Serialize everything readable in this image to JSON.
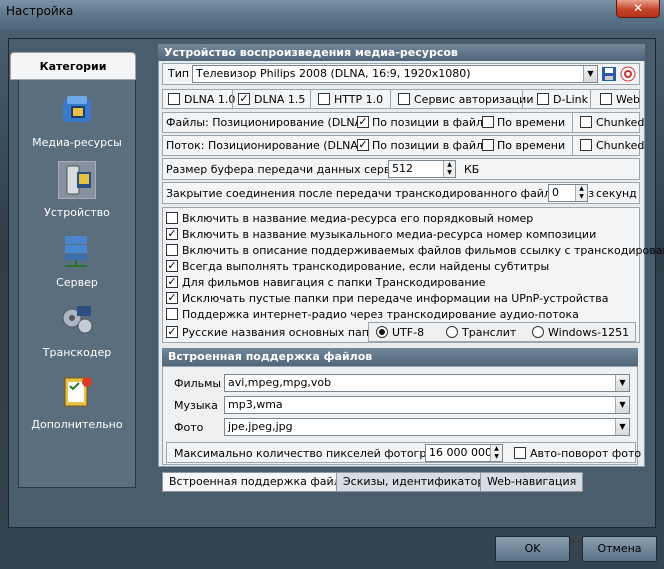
{
  "window": {
    "title": "Настройка",
    "close_icon": "close-icon"
  },
  "sidebar": {
    "header": "Категории",
    "items": [
      {
        "label": "Медиа-ресурсы",
        "icon": "media-resources-icon"
      },
      {
        "label": "Устройство",
        "icon": "device-icon"
      },
      {
        "label": "Сервер",
        "icon": "server-icon"
      },
      {
        "label": "Транскодер",
        "icon": "transcoder-icon"
      },
      {
        "label": "Дополнительно",
        "icon": "additional-icon"
      }
    ]
  },
  "panel": {
    "title": "Устройство воспроизведения медиа-ресурсов",
    "type_label": "Тип",
    "type_value": "Телевизор Philips 2008 (DLNA, 16:9, 1920x1080)",
    "flags": [
      {
        "label": "DLNA 1.0",
        "checked": false
      },
      {
        "label": "DLNA 1.5",
        "checked": true
      },
      {
        "label": "HTTP 1.0",
        "checked": false
      },
      {
        "label": "Сервис авторизации",
        "checked": false
      },
      {
        "label": "D-Link",
        "checked": false
      },
      {
        "label": "Web",
        "checked": false
      }
    ],
    "files_pos_label": "Файлы: Позиционирование (DLNA):",
    "stream_pos_label": "Поток: Позиционирование (DLNA):",
    "by_position": "По позиции в файле",
    "by_time": "По времени",
    "chunked": "Chunked",
    "buffer_label": "Размер буфера передачи данных сервера",
    "buffer_value": "512",
    "buffer_unit": "КБ",
    "close_label": "Закрытие соединения после передачи транскодированного файла через",
    "close_value": "0",
    "close_unit": "секунд",
    "options": [
      {
        "label": "Включить в название медиа-ресурса его порядковый номер",
        "checked": false
      },
      {
        "label": "Включить в название музыкального медиа-ресурса номер композиции",
        "checked": true
      },
      {
        "label": "Включить в описание поддерживаемых файлов фильмов ссылку с транскодированием",
        "checked": false
      },
      {
        "label": "Всегда выполнять транскодирование, если найдены субтитры",
        "checked": true
      },
      {
        "label": "Для фильмов навигация с папки Транскодирование",
        "checked": true
      },
      {
        "label": "Исключать пустые папки при передаче информации на  UPnP-устройства",
        "checked": true
      },
      {
        "label": "Поддержка интернет-радио через транскодирование аудио-потока",
        "checked": false
      },
      {
        "label": "Русские названия основных папок",
        "checked": true
      }
    ],
    "encodings": [
      {
        "label": "UTF-8",
        "selected": true
      },
      {
        "label": "Транслит",
        "selected": false
      },
      {
        "label": "Windows-1251",
        "selected": false
      }
    ]
  },
  "builtin": {
    "title": "Встроенная поддержка файлов",
    "movies_label": "Фильмы",
    "movies_value": "avi,mpeg,mpg,vob",
    "music_label": "Музыка",
    "music_value": "mp3,wma",
    "photo_label": "Фото",
    "photo_value": "jpe,jpeg,jpg",
    "max_pixels_label": "Максимально количество пикселей фотографий",
    "max_pixels_value": "16 000 000",
    "autorotate_label": "Авто-поворот фото"
  },
  "tabs": [
    "Встроенная поддержка файлов",
    "Эскизы, идентификаторы",
    "Web-навигация"
  ],
  "buttons": {
    "ok": "OK",
    "cancel": "Отмена"
  }
}
